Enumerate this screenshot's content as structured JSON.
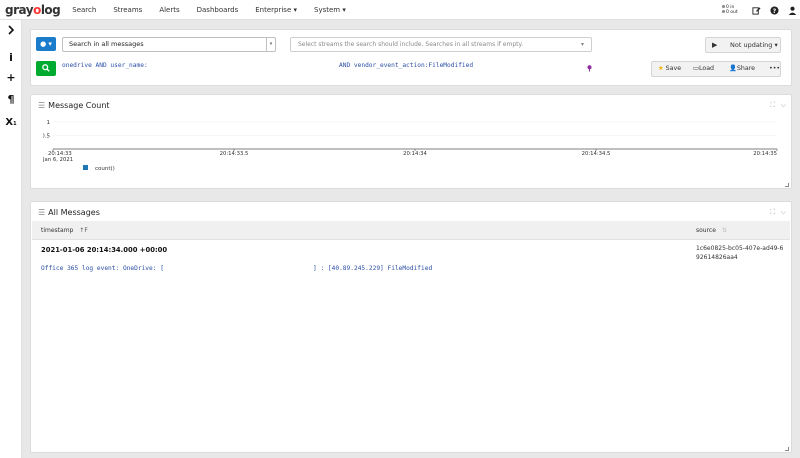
{
  "nav": {
    "logo_pre": "gray",
    "logo_o": "o",
    "logo_post": "log",
    "items": [
      "Search",
      "Streams",
      "Alerts",
      "Dashboards",
      "Enterprise ▾",
      "System ▾"
    ],
    "io_in": "0 in",
    "io_out": "0 out"
  },
  "search": {
    "stream_btn": "● ▾",
    "scope_value": "Search in all messages",
    "streams_placeholder": "Select streams the search should include. Searches in all streams if empty.",
    "query_part1": "onedrive AND user_name:",
    "query_part2": "AND vendor_event_action:FileModified",
    "refresh_label": "Not updating ▾",
    "save_label": "Save",
    "load_label": "Load",
    "share_label": "Share",
    "more_label": "•••"
  },
  "message_count": {
    "title": "Message Count"
  },
  "chart_data": {
    "type": "bar",
    "title": "Message Count",
    "x_ticks": [
      "20:14:33",
      "20:14:33.5",
      "20:14:34",
      "20:14:34.5",
      "20:14:35"
    ],
    "x_date_label": "Jan 6, 2021",
    "y_ticks": [
      "1",
      "0.5"
    ],
    "ylim": [
      0,
      1
    ],
    "series": [
      {
        "name": "count()",
        "values": []
      }
    ],
    "legend_color": "#1f77b4",
    "grid": true
  },
  "all_messages": {
    "title": "All Messages",
    "columns": {
      "timestamp": "timestamp",
      "source": "source"
    },
    "sort_glyph": "↑F",
    "messages": [
      {
        "timestamp": "2021-01-06 20:14:34.000 +00:00",
        "source": "1c6e0825-bc05-407e-ad49-692614826aa4",
        "text_part1": "Office 365 log event: OneDrive: [",
        "text_part2": "] : [40.89.245.229] FileModified"
      }
    ]
  }
}
